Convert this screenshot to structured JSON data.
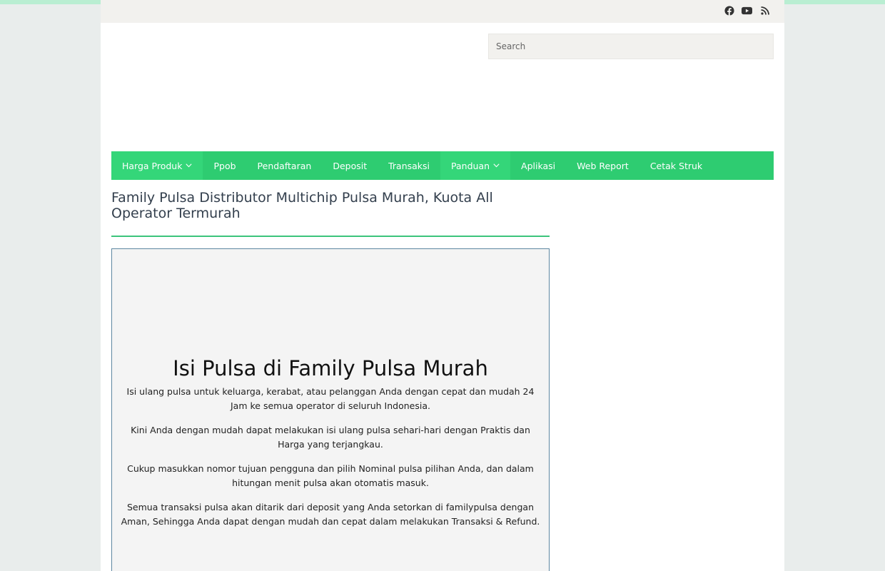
{
  "topbar": {
    "social": [
      {
        "icon": "facebook-icon",
        "label": "Facebook"
      },
      {
        "icon": "youtube-icon",
        "label": "YouTube"
      },
      {
        "icon": "rss-icon",
        "label": "RSS"
      }
    ]
  },
  "search": {
    "placeholder": "Search"
  },
  "nav": {
    "items": [
      {
        "label": "Harga Produk",
        "has_dropdown": true
      },
      {
        "label": "Ppob"
      },
      {
        "label": "Pendaftaran"
      },
      {
        "label": "Deposit"
      },
      {
        "label": "Transaksi"
      },
      {
        "label": "Panduan",
        "has_dropdown": true
      },
      {
        "label": "Aplikasi"
      },
      {
        "label": "Web Report"
      },
      {
        "label": "Cetak Struk"
      }
    ]
  },
  "page": {
    "title": "Family Pulsa Distributor Multichip Pulsa Murah, Kuota All Operator Termurah"
  },
  "content": {
    "heading": "Isi Pulsa di Family Pulsa Murah",
    "paragraphs": [
      "Isi ulang pulsa untuk keluarga, kerabat, atau pelanggan Anda dengan cepat dan mudah 24 Jam ke semua operator di seluruh Indonesia.",
      "Kini Anda dengan mudah dapat melakukan isi ulang pulsa sehari-hari dengan Praktis dan Harga yang terjangkau.",
      "Cukup masukkan nomor tujuan pengguna dan pilih Nominal pulsa pilihan Anda, dan dalam hitungan menit pulsa akan otomatis masuk.",
      "Semua transaksi pulsa akan ditarik dari deposit yang Anda setorkan di familypulsa dengan Aman, Sehingga Anda dapat dengan mudah dan cepat dalam melakukan Transaksi & Refund."
    ]
  },
  "colors": {
    "nav_bg": "#2ecc71",
    "nav_active": "#34d679",
    "accent_rule": "#3cc47c",
    "box_border": "#5d87a1"
  }
}
